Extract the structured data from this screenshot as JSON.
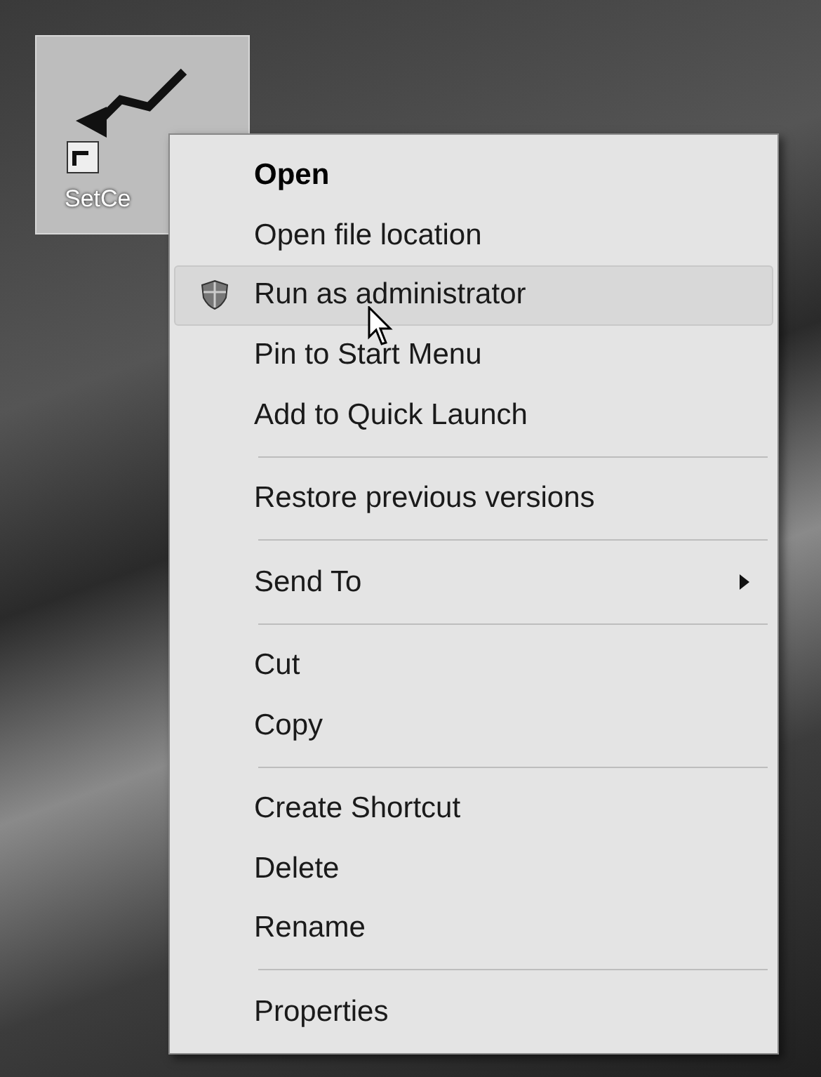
{
  "desktop_icon": {
    "label": "SetCe",
    "selected": true
  },
  "context_menu": {
    "groups": [
      [
        {
          "label": "Open",
          "kind": "default",
          "selected": false
        },
        {
          "label": "Open file location",
          "kind": "normal",
          "selected": false
        },
        {
          "label": "Run as administrator",
          "kind": "elevated",
          "selected": true
        },
        {
          "label": "Pin to Start Menu",
          "kind": "normal",
          "selected": false
        },
        {
          "label": "Add to Quick Launch",
          "kind": "normal",
          "selected": false
        }
      ],
      [
        {
          "label": "Restore previous versions",
          "kind": "normal",
          "selected": false
        }
      ],
      [
        {
          "label": "Send To",
          "kind": "submenu",
          "selected": false
        }
      ],
      [
        {
          "label": "Cut",
          "kind": "normal",
          "selected": false
        },
        {
          "label": "Copy",
          "kind": "normal",
          "selected": false
        }
      ],
      [
        {
          "label": "Create Shortcut",
          "kind": "normal",
          "selected": false
        },
        {
          "label": "Delete",
          "kind": "normal",
          "selected": false
        },
        {
          "label": "Rename",
          "kind": "normal",
          "selected": false
        }
      ],
      [
        {
          "label": "Properties",
          "kind": "normal",
          "selected": false
        }
      ]
    ]
  }
}
